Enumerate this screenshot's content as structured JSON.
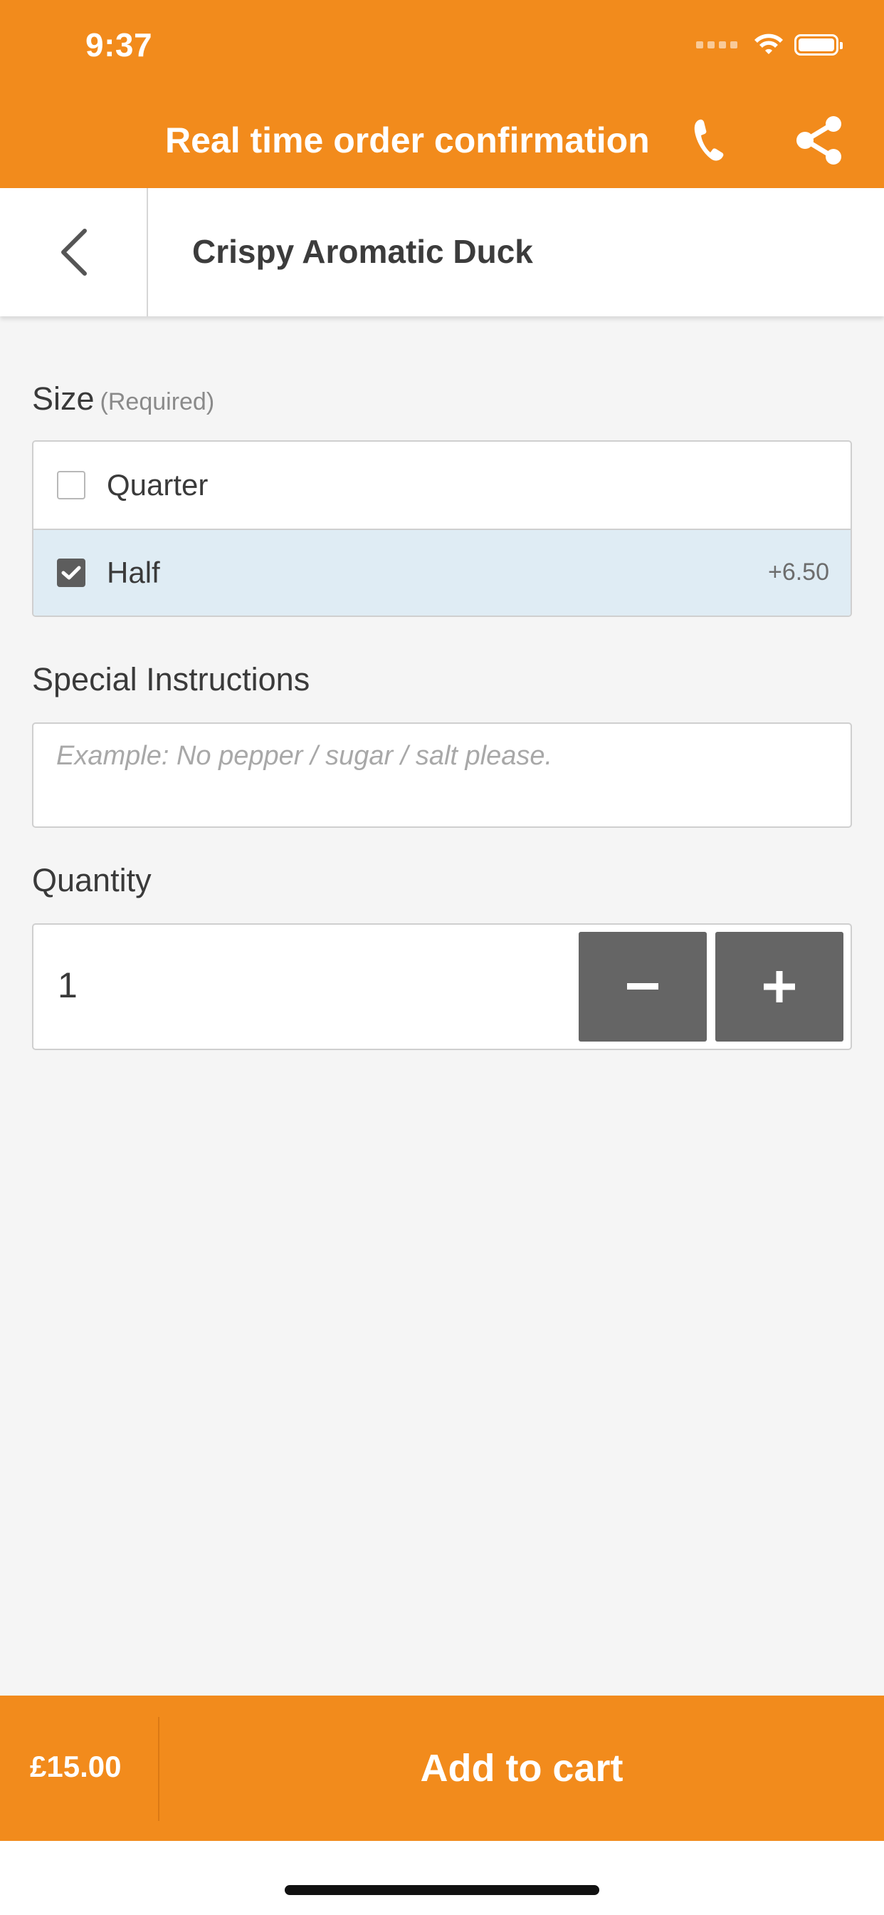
{
  "status_bar": {
    "time": "9:37"
  },
  "topbar": {
    "title": "Real time order confirmation",
    "phone_icon": "phone-icon",
    "share_icon": "share-icon"
  },
  "header": {
    "back_icon": "chevron-left-icon",
    "item_title": "Crispy Aromatic Duck"
  },
  "size": {
    "label": "Size",
    "required": "(Required)",
    "options": [
      {
        "label": "Quarter",
        "price": "",
        "checked": false
      },
      {
        "label": "Half",
        "price": "+6.50",
        "checked": true
      }
    ]
  },
  "instructions": {
    "label": "Special Instructions",
    "placeholder": "Example: No pepper / sugar / salt please.",
    "value": ""
  },
  "quantity": {
    "label": "Quantity",
    "value": "1",
    "minus": "−",
    "plus": "+"
  },
  "cart": {
    "price": "£15.00",
    "button_label": "Add to cart"
  },
  "colors": {
    "accent": "#F28B1C",
    "selected_row": "#dfecf4",
    "button_dark": "#656565"
  }
}
